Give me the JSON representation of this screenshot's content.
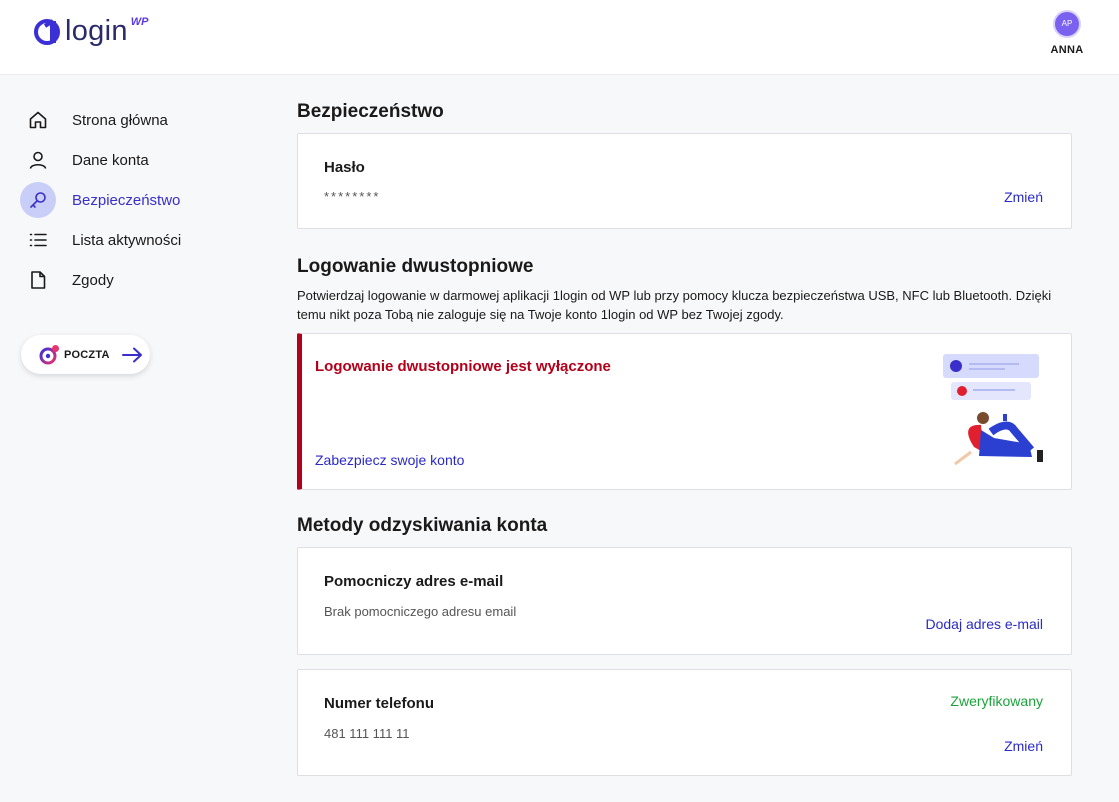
{
  "header": {
    "logo_text": "login",
    "logo_suffix": "WP",
    "user": {
      "initials": "AP",
      "name": "ANNA"
    }
  },
  "sidebar": {
    "items": [
      {
        "label": "Strona główna",
        "icon": "home-icon"
      },
      {
        "label": "Dane konta",
        "icon": "user-icon"
      },
      {
        "label": "Bezpieczeństwo",
        "icon": "key-icon",
        "active": true
      },
      {
        "label": "Lista aktywności",
        "icon": "list-icon"
      },
      {
        "label": "Zgody",
        "icon": "document-icon"
      }
    ],
    "mail_button": {
      "label": "POCZTA",
      "icon": "poczta-logo-icon"
    }
  },
  "security": {
    "title": "Bezpieczeństwo",
    "password": {
      "title": "Hasło",
      "value": "********",
      "action": "Zmień"
    }
  },
  "two_factor": {
    "title": "Logowanie dwustopniowe",
    "description": "Potwierdzaj logowanie w darmowej aplikacji 1login od WP lub przy pomocy klucza bezpieczeństwa USB, NFC lub Bluetooth. Dzięki temu nikt poza Tobą nie zaloguje się na Twoje konto 1login od WP bez Twojej zgody.",
    "status": "Logowanie dwustopniowe jest wyłączone",
    "action": "Zabezpiecz swoje konto"
  },
  "recovery": {
    "title": "Metody odzyskiwania konta",
    "email": {
      "title": "Pomocniczy adres e-mail",
      "value": "Brak pomocniczego adresu email",
      "action": "Dodaj adres e-mail"
    },
    "phone": {
      "title": "Numer telefonu",
      "value": "481 111 111 11",
      "status": "Zweryfikowany",
      "action": "Zmień"
    }
  },
  "colors": {
    "accent": "#3a2fc9",
    "link": "#2a2ac7",
    "danger": "#b3001b",
    "success": "#1aa33a",
    "active_bg": "#c8cef7"
  }
}
